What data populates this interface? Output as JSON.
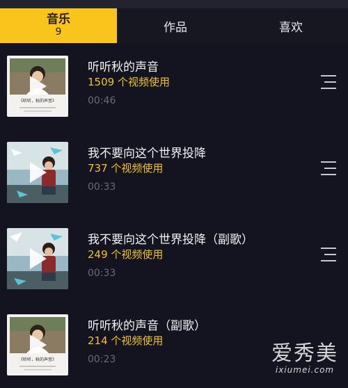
{
  "tabs": {
    "music_label": "音乐",
    "music_count": "9",
    "works_label": "作品",
    "likes_label": "喜欢"
  },
  "colors": {
    "accent": "#f9c41b",
    "background": "#141420",
    "use_count": "#f3c22a",
    "duration": "#6a6a76"
  },
  "tracks": [
    {
      "title": "听听秋的声音",
      "uses": "1509 个视频使用",
      "duration": "00:46",
      "cover": "boy-white-poster",
      "cover_caption": "《听听，秋的声音》"
    },
    {
      "title": "我不要向这个世界投降",
      "uses": "737 个视频使用",
      "duration": "00:33",
      "cover": "boy-paper-planes"
    },
    {
      "title": "我不要向这个世界投降（副歌）",
      "uses": "249 个视频使用",
      "duration": "00:33",
      "cover": "boy-paper-planes"
    },
    {
      "title": "听听秋的声音（副歌）",
      "uses": "214 个视频使用",
      "duration": "00:23",
      "cover": "boy-white-poster",
      "cover_caption": "《听听，秋的声音》"
    }
  ],
  "icons": {
    "play": "play-icon",
    "menu": "playlist-menu-icon"
  },
  "watermark": {
    "main": "爱秀美",
    "sub": "ixiumei.com"
  }
}
